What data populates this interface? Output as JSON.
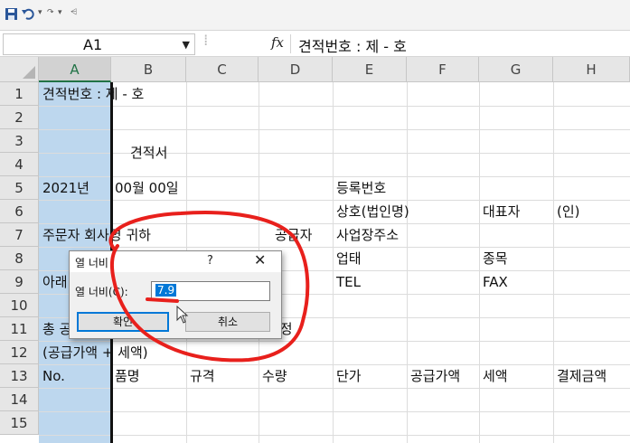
{
  "formula_bar": {
    "name_box": "A1",
    "fx": "fx",
    "content": "견적번호 : 제  -  호"
  },
  "columns": [
    "A",
    "B",
    "C",
    "D",
    "E",
    "F",
    "G",
    "H"
  ],
  "rows": [
    "1",
    "2",
    "3",
    "4",
    "5",
    "6",
    "7",
    "8",
    "9",
    "10",
    "11",
    "12",
    "13",
    "14",
    "15"
  ],
  "cells": {
    "a1": "견적번호 : 제  -  호",
    "b3": "견적서",
    "a5": "2021년",
    "b5": "00월  00일",
    "e5": "등록번호",
    "e6": "상호(법인명)",
    "g6": "대표자",
    "h6": "(인)",
    "a7": "주문자 회사명   귀하",
    "d7": "공급자",
    "e7": "사업장주소",
    "e8": "업태",
    "g8": "종목",
    "a9": "아래",
    "e9": "TEL",
    "g9": "FAX",
    "a11": "총 공",
    "d11": "원정",
    "a12": "(공급가액 + 세액)",
    "a13": "No.",
    "b13": "품명",
    "c13": "규격",
    "d13": "수량",
    "e13": "단가",
    "f13": "공급가액",
    "g13": "세액",
    "h13": "결제금액"
  },
  "dialog": {
    "title": "열 너비",
    "help": "?",
    "close": "✕",
    "label": "열 너비(C):",
    "value": "7.9",
    "ok": "확인",
    "cancel": "취소"
  },
  "colors": {
    "selected_column": "#bdd7ee",
    "annotation": "#e8201c",
    "accent": "#0078d7"
  }
}
